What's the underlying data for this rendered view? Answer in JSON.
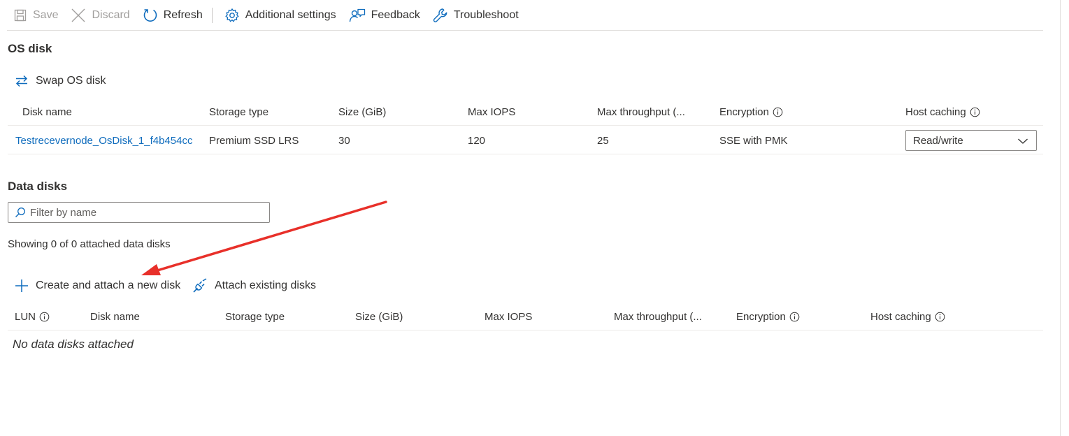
{
  "toolbar": {
    "save_label": "Save",
    "discard_label": "Discard",
    "refresh_label": "Refresh",
    "additional_settings_label": "Additional settings",
    "feedback_label": "Feedback",
    "troubleshoot_label": "Troubleshoot"
  },
  "os_disk": {
    "title": "OS disk",
    "swap_label": "Swap OS disk",
    "columns": {
      "disk_name": "Disk name",
      "storage_type": "Storage type",
      "size": "Size (GiB)",
      "max_iops": "Max IOPS",
      "max_throughput": "Max throughput (...",
      "encryption": "Encryption",
      "host_caching": "Host caching"
    },
    "row": {
      "disk_name": "Testrecevernode_OsDisk_1_f4b454cc",
      "storage_type": "Premium SSD LRS",
      "size": "30",
      "max_iops": "120",
      "max_throughput": "25",
      "encryption": "SSE with PMK",
      "host_caching": "Read/write"
    }
  },
  "data_disks": {
    "title": "Data disks",
    "filter_placeholder": "Filter by name",
    "showing_text": "Showing 0 of 0 attached data disks",
    "create_label": "Create and attach a new disk",
    "attach_label": "Attach existing disks",
    "columns": {
      "lun": "LUN",
      "disk_name": "Disk name",
      "storage_type": "Storage type",
      "size": "Size (GiB)",
      "max_iops": "Max IOPS",
      "max_throughput": "Max throughput (...",
      "encryption": "Encryption",
      "host_caching": "Host caching"
    },
    "empty_text": "No data disks attached"
  },
  "colors": {
    "accent": "#0f6cbd",
    "annotation_arrow": "#e8302a",
    "disabled_text": "#a19f9d"
  },
  "icons": {
    "save": "save-icon",
    "discard": "close-icon",
    "refresh": "refresh-icon",
    "settings": "gear-icon",
    "feedback": "feedback-icon",
    "troubleshoot": "wrench-icon",
    "swap": "swap-icon",
    "info": "info-icon",
    "chevron": "chevron-down-icon",
    "search": "search-icon",
    "add": "plus-icon",
    "attach": "plug-icon"
  }
}
